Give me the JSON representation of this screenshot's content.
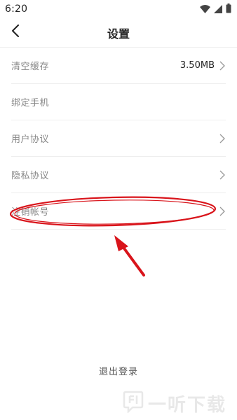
{
  "status_bar": {
    "time": "6:20",
    "icons": [
      "wifi-icon",
      "cellular-signal-icon",
      "battery-icon"
    ]
  },
  "header": {
    "back_icon": "chevron-left-icon",
    "title": "设置"
  },
  "settings": {
    "items": [
      {
        "label": "清空缓存",
        "value": "3.50MB",
        "has_chevron": true
      },
      {
        "label": "绑定手机",
        "value": "",
        "has_chevron": false
      },
      {
        "label": "用户协议",
        "value": "",
        "has_chevron": true
      },
      {
        "label": "隐私协议",
        "value": "",
        "has_chevron": true
      },
      {
        "label": "注销帐号",
        "value": "",
        "has_chevron": true
      }
    ]
  },
  "logout_label": "退出登录",
  "annotation": {
    "color": "#d9141b",
    "target": "注销帐号"
  },
  "watermark": {
    "text": "一听下载",
    "icon": "ting-logo-icon"
  },
  "colors": {
    "label": "#888888",
    "divider": "#eeeeee",
    "annotation": "#d9141b"
  }
}
